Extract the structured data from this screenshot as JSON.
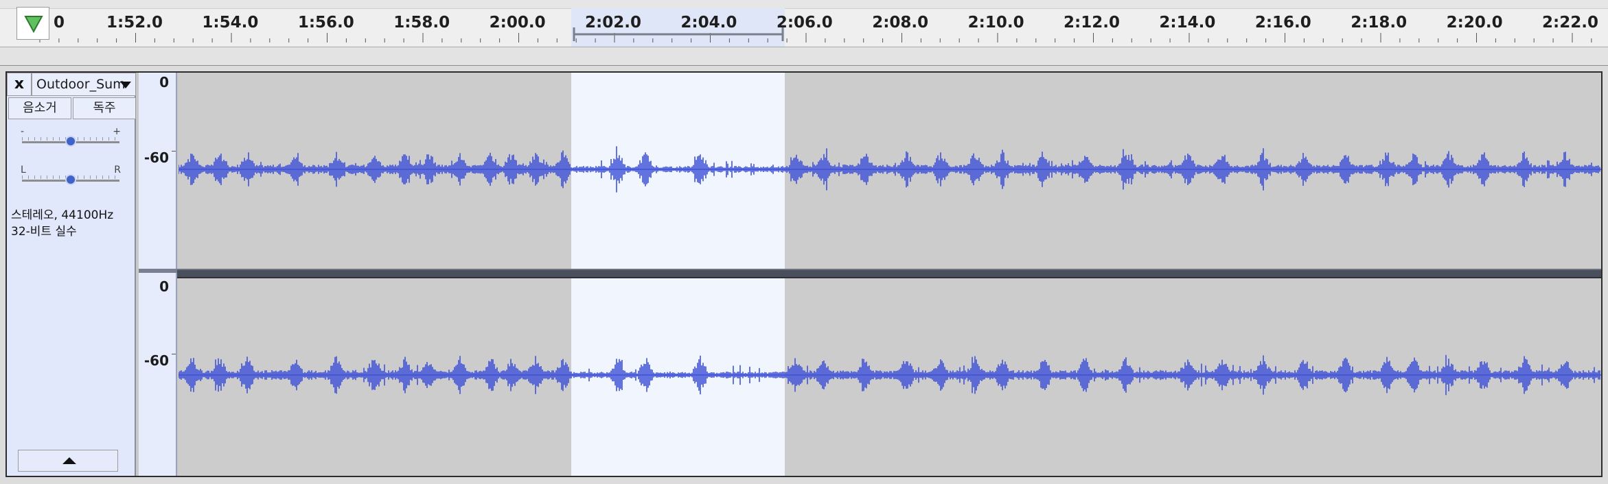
{
  "ruler": {
    "tick_labels": [
      "0",
      "1:52.0",
      "1:54.0",
      "1:56.0",
      "1:58.0",
      "2:00.0",
      "2:02.0",
      "2:04.0",
      "2:06.0",
      "2:08.0",
      "2:10.0",
      "2:12.0",
      "2:14.0",
      "2:16.0",
      "2:18.0",
      "2:20.0",
      "2:22.0"
    ],
    "selection_start": "2:02.0",
    "selection_end": "2:06.0"
  },
  "track": {
    "close_label": "x",
    "name": "Outdoor_Sum",
    "mute_label": "음소거",
    "solo_label": "독주",
    "gain_min_label": "-",
    "gain_max_label": "+",
    "pan_left_label": "L",
    "pan_right_label": "R",
    "gain_level": 0.5,
    "pan_level": 0.5,
    "info_line1": "스테레오, 44100Hz",
    "info_line2": "32-비트 실수"
  },
  "vertical_ruler": {
    "top_label": "0",
    "mid_label": "-60"
  },
  "colors": {
    "waveform": "#3f51d6",
    "selection": "#f1f5fe",
    "background": "#cccccc",
    "track_panel": "#e2e8fb"
  }
}
